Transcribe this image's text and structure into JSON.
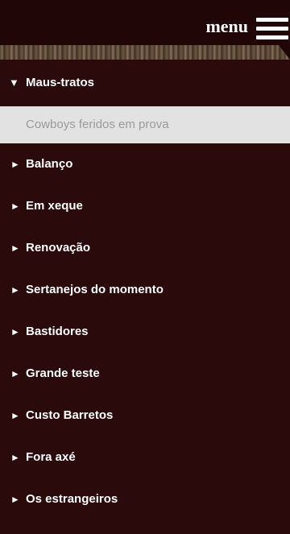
{
  "header": {
    "menu_label": "menu",
    "menu_icon": "hamburger-icon"
  },
  "menu": {
    "open_item": {
      "label": "Maus-tratos",
      "arrow": "▼",
      "subitem": "Cowboys feridos em prova"
    },
    "items": [
      {
        "label": "Balanço",
        "arrow": "►"
      },
      {
        "label": "Em xeque",
        "arrow": "►"
      },
      {
        "label": "Renovação",
        "arrow": "►"
      },
      {
        "label": "Sertanejos do momento",
        "arrow": "►"
      },
      {
        "label": "Bastidores",
        "arrow": "►"
      },
      {
        "label": "Grande teste",
        "arrow": "►"
      },
      {
        "label": "Custo Barretos",
        "arrow": "►"
      },
      {
        "label": "Fora axé",
        "arrow": "►"
      },
      {
        "label": "Os estrangeiros",
        "arrow": "►"
      }
    ]
  },
  "colors": {
    "menu_bg": "#2a0a0b",
    "header_bg": "#200607",
    "subitem_bg": "#e2e2e2",
    "subitem_text": "#9a9a9a"
  }
}
